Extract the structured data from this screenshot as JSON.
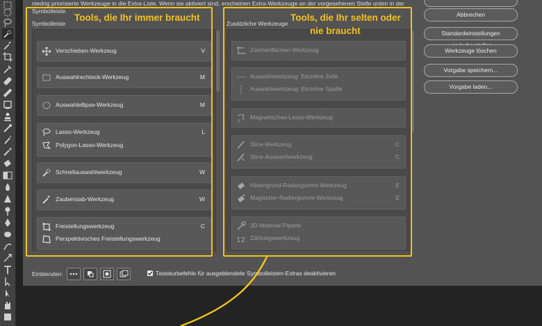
{
  "description": "niedrig priorisierte Werkzeuge in die Extra-Liste. Wenn sie aktiviert sind, erscheinen Extra-Werkzeuge an der vorgesehenen Stelle unten in der Symbolleiste.",
  "left_panel": {
    "title": "Symbolleiste",
    "groups": [
      {
        "tools": [
          {
            "name": "Verschieben-Werkzeug",
            "key": "V",
            "icon": "move-icon"
          }
        ]
      },
      {
        "tools": [
          {
            "name": "Auswahlrechteck-Werkzeug",
            "key": "M",
            "icon": "rectangle-marquee-icon"
          }
        ]
      },
      {
        "tools": [
          {
            "name": "Auswahlellipse-Werkzeug",
            "key": "M",
            "icon": "elliptical-marquee-icon"
          }
        ]
      },
      {
        "tools": [
          {
            "name": "Lasso-Werkzeug",
            "key": "L",
            "icon": "lasso-icon"
          },
          {
            "name": "Polygon-Lasso-Werkzeug",
            "key": "",
            "icon": "polygon-lasso-icon"
          }
        ]
      },
      {
        "tools": [
          {
            "name": "Schnellauswahlwerkzeug",
            "key": "W",
            "icon": "quick-selection-icon"
          }
        ]
      },
      {
        "tools": [
          {
            "name": "Zauberstab-Werkzeug",
            "key": "W",
            "icon": "magic-wand-icon"
          }
        ]
      },
      {
        "tools": [
          {
            "name": "Freistellungswerkzeug",
            "key": "C",
            "icon": "crop-icon"
          },
          {
            "name": "Perspektivisches Freistellungswerkzeug",
            "key": "",
            "icon": "perspective-crop-icon"
          }
        ]
      }
    ]
  },
  "right_panel": {
    "title": "Zusätzliche Werkzeuge",
    "groups": [
      {
        "tools": [
          {
            "name": "Zeichenflächen-Werkzeug",
            "key": "",
            "icon": "artboard-icon"
          }
        ]
      },
      {
        "tools": [
          {
            "name": "Auswahlwerkzeug: Einzelne Zeile",
            "key": "",
            "icon": "single-row-marquee-icon"
          },
          {
            "name": "Auswahlwerkzeug: Einzelne Spalte",
            "key": "",
            "icon": "single-column-marquee-icon"
          }
        ]
      },
      {
        "tools": [
          {
            "name": "Magnetisches-Lasso-Werkzeug",
            "key": "",
            "icon": "magnetic-lasso-icon"
          }
        ]
      },
      {
        "tools": [
          {
            "name": "Slice-Werkzeug",
            "key": "C",
            "icon": "slice-icon"
          },
          {
            "name": "Slice-Auswahlwerkzeug",
            "key": "C",
            "icon": "slice-select-icon"
          }
        ]
      },
      {
        "tools": [
          {
            "name": "Hintergrund-Radiergummi-Werkzeug",
            "key": "E",
            "icon": "background-eraser-icon"
          },
          {
            "name": "Magischer-Radiergummi-Werkzeug",
            "key": "E",
            "icon": "magic-eraser-icon"
          }
        ]
      },
      {
        "tools": [
          {
            "name": "3D-Material-Pipette",
            "key": "",
            "icon": "3d-material-eyedropper-icon"
          },
          {
            "name": "Zählungswerkzeug",
            "key": "",
            "icon": "count-icon"
          }
        ]
      }
    ]
  },
  "buttons": {
    "abbrechen": "Abbrechen",
    "reset": "Standardeinstellungen wiederherstellen",
    "clear": "Werkzeuge löschen",
    "save_preset": "Vorgabe speichern...",
    "load_preset": "Vorgabe laden..."
  },
  "annotations": {
    "left": "Tools, die Ihr immer braucht",
    "right_line1": "Tools, die Ihr selten oder",
    "right_line2": "nie braucht",
    "color": "#f0c419"
  },
  "bottom": {
    "einblenden_label": "Einblenden:",
    "checkbox_label": "Tastaturbefehle für ausgeblendete Symbolleisten-Extras deaktivieren",
    "checkbox_checked": true
  }
}
